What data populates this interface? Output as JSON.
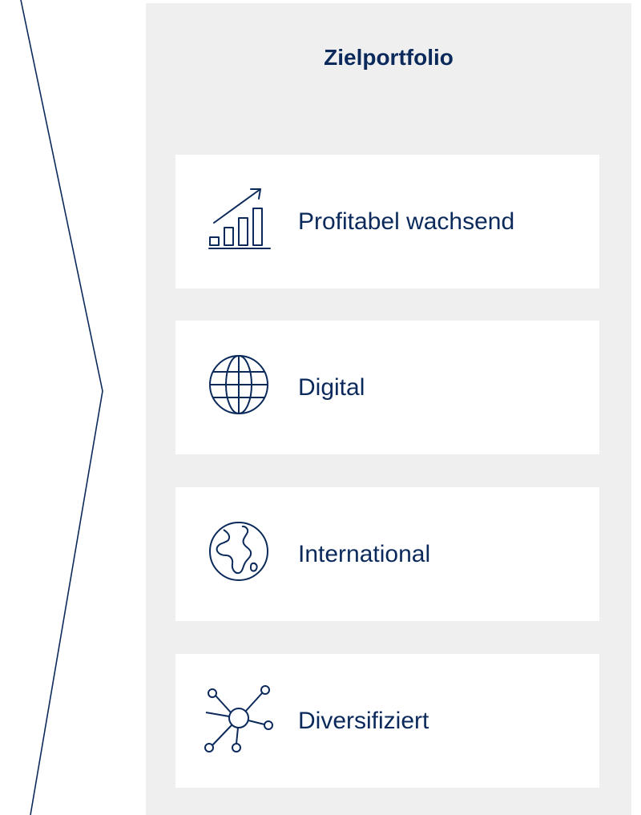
{
  "title": "Zielportfolio",
  "accent_color": "#0b2a5b",
  "panel_color": "#efefef",
  "items": [
    {
      "label": "Profitabel wachsend",
      "icon": "growth-chart-icon"
    },
    {
      "label": "Digital",
      "icon": "globe-grid-icon"
    },
    {
      "label": "International",
      "icon": "world-map-icon"
    },
    {
      "label": "Diversifiziert",
      "icon": "network-hub-icon"
    }
  ]
}
